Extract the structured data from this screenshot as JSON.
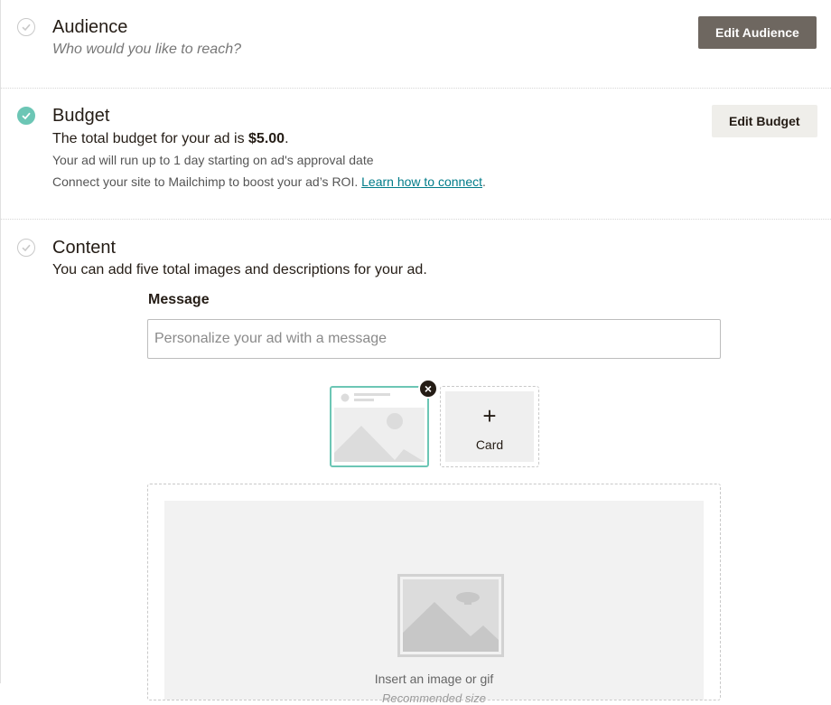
{
  "audience": {
    "title": "Audience",
    "subtitle": "Who would you like to reach?",
    "button": "Edit Audience"
  },
  "budget": {
    "title": "Budget",
    "line1_prefix": "The total budget for your ad is ",
    "amount": "$5.00",
    "line1_suffix": ".",
    "line2": "Your ad will run up to 1 day starting on ad's approval date",
    "line3_prefix": "Connect your site to Mailchimp to boost your ad’s ROI. ",
    "line3_link": "Learn how to connect",
    "line3_suffix": ".",
    "button": "Edit Budget"
  },
  "content": {
    "title": "Content",
    "description": "You can add five total images and descriptions for your ad.",
    "message_label": "Message",
    "message_placeholder": "Personalize your ad with a message",
    "add_card_plus": "+",
    "add_card_label": "Card",
    "remove_glyph": "×",
    "drop_text": "Insert an image or gif",
    "drop_subtext": "Recommended size"
  },
  "colors": {
    "accent": "#6cc6b5",
    "primary_button": "#6e6760",
    "secondary_button": "#efeeea",
    "link": "#007c89"
  },
  "icons": {
    "audience_status": "check-circle-outline-icon",
    "budget_status": "check-circle-filled-icon",
    "content_status": "check-circle-outline-icon",
    "card_thumbnail": "image-placeholder-icon",
    "remove_card": "close-icon",
    "add_card": "plus-icon",
    "drop_area": "image-placeholder-icon"
  }
}
